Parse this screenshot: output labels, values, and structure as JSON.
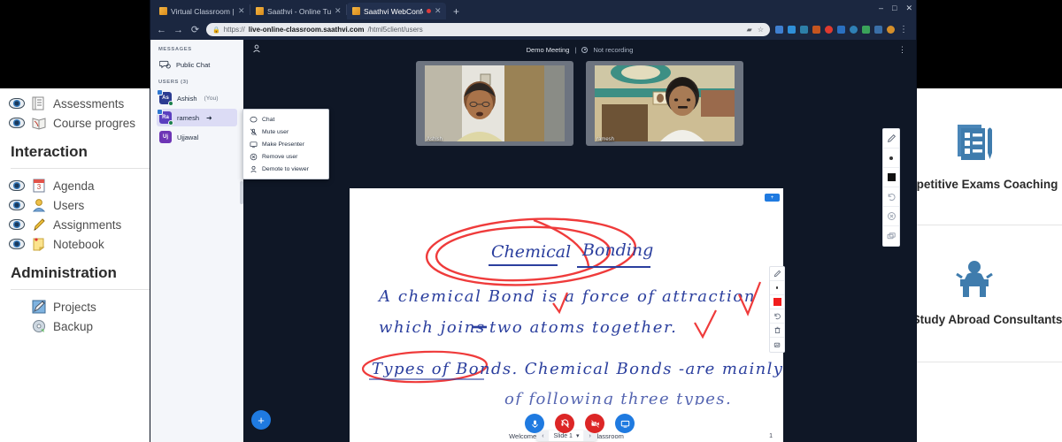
{
  "browser": {
    "tabs": [
      {
        "title": "Virtual Classroom | Live o",
        "active": false,
        "recording": false
      },
      {
        "title": "Saathvi - Online Tutor | Liv",
        "active": false,
        "recording": false
      },
      {
        "title": "Saathvi WebConferenc",
        "active": true,
        "recording": true
      }
    ],
    "new_tab_label": "+",
    "window_controls": {
      "minimize": "–",
      "maximize": "□",
      "close": "✕"
    },
    "nav": {
      "back": "←",
      "forward": "→",
      "reload": "⟳"
    },
    "omnibox": {
      "lock_icon": "lock-icon",
      "url_prefix": "https://",
      "url_domain": "live-online-classroom.saathvi.com",
      "url_path": "/html5client/users",
      "bookmark_icon": "star-icon",
      "cast_icon": "cast-icon"
    },
    "extensions": [
      "#3f7fd0",
      "#2f8fd8",
      "#2d7fa8",
      "#c4551f",
      "#e03a2f",
      "#2a6fc0",
      "#2f80b5",
      "#3aa35a",
      "#3a6fa8",
      "#d58f2a"
    ],
    "menu_icon": "kebab-menu-icon"
  },
  "meeting": {
    "title": "Demo Meeting",
    "separator": "|",
    "recording_status": "Not recording",
    "options_icon": "kebab-menu-icon",
    "user_icon": "user-list-icon"
  },
  "sidebar": {
    "messages_heading": "MESSAGES",
    "public_chat": "Public Chat",
    "users_heading": "USERS (3)",
    "users": [
      {
        "name": "Ashish",
        "suffix": "(You)",
        "initials": "As",
        "color": "#2c3c91",
        "presenter": true,
        "selected": false
      },
      {
        "name": "ramesh",
        "suffix": "",
        "initials": "Ra",
        "color": "#5b3fbf",
        "presenter": true,
        "selected": true
      },
      {
        "name": "Ujjawal",
        "suffix": "",
        "initials": "Uj",
        "color": "#6d35b5",
        "presenter": false,
        "selected": false
      }
    ]
  },
  "context_menu": {
    "items": [
      {
        "label": "Chat",
        "icon": "chat-bubble-icon"
      },
      {
        "label": "Mute user",
        "icon": "microphone-slash-icon"
      },
      {
        "label": "Make Presenter",
        "icon": "presentation-screen-icon"
      },
      {
        "label": "Remove user",
        "icon": "circle-x-icon"
      },
      {
        "label": "Demote to viewer",
        "icon": "person-icon"
      }
    ]
  },
  "videos": [
    {
      "label": "Ashish"
    },
    {
      "label": "ramesh"
    }
  ],
  "whiteboard": {
    "title_line": "Chemical Bonding",
    "body_lines": [
      "A chemical Bond is a force of attraction",
      "which joins  two atoms together.",
      "Types of Bonds. Chemical Bonds -are mainly",
      "of following three types."
    ],
    "footer_title": "Welcome To Saathvi Online Classroom",
    "page_number": "1",
    "slide_selector": {
      "prev": "‹",
      "next": "›",
      "current": "Slide 1",
      "caret": "▾"
    },
    "badge_label": "+",
    "tools": [
      {
        "icon": "pencil-tool-icon",
        "name": "pencil"
      },
      {
        "icon": "thickness-dot-icon",
        "name": "thickness"
      },
      {
        "icon": "color-swatch-icon",
        "name": "color",
        "color": "#f11c1c"
      },
      {
        "icon": "undo-icon",
        "name": "undo"
      },
      {
        "icon": "trash-icon",
        "name": "clear"
      },
      {
        "icon": "multi-user-whiteboard-icon",
        "name": "multi-user"
      }
    ],
    "outer_tools": [
      {
        "icon": "pencil-tool-icon",
        "name": "pencil"
      },
      {
        "icon": "thickness-dot-icon",
        "name": "thickness"
      },
      {
        "icon": "color-swatch-icon",
        "name": "color",
        "color": "#111111"
      },
      {
        "icon": "undo-icon",
        "name": "undo"
      },
      {
        "icon": "circle-x-icon",
        "name": "clear-all"
      },
      {
        "icon": "multi-user-whiteboard-icon",
        "name": "multi-user"
      }
    ]
  },
  "actionbar": {
    "add_label": "+",
    "buttons": [
      {
        "name": "microphone-button",
        "icon": "microphone-icon",
        "state": "blue"
      },
      {
        "name": "leave-audio-button",
        "icon": "headset-slash-icon",
        "state": "red"
      },
      {
        "name": "camera-button",
        "icon": "camera-slash-icon",
        "state": "red"
      },
      {
        "name": "share-screen-button",
        "icon": "screen-share-icon",
        "state": "blue"
      }
    ]
  },
  "lms_left": {
    "top_items": [
      {
        "label": "Assessments",
        "icon": "assessments-icon"
      },
      {
        "label": "Course progres",
        "icon": "course-progress-icon"
      }
    ],
    "sections": [
      {
        "heading": "Interaction",
        "items": [
          {
            "label": "Agenda",
            "icon": "agenda-icon"
          },
          {
            "label": "Users",
            "icon": "users-icon"
          },
          {
            "label": "Assignments",
            "icon": "assignments-icon"
          },
          {
            "label": "Notebook",
            "icon": "notebook-icon"
          }
        ]
      },
      {
        "heading": "Administration",
        "items": [
          {
            "label": "Projects",
            "icon": "projects-icon"
          },
          {
            "label": "Backup",
            "icon": "backup-icon"
          }
        ]
      }
    ]
  },
  "lms_right": {
    "cards": [
      {
        "label": "Competitive Exams Coaching",
        "icon": "exam-paper-pencil-icon"
      },
      {
        "label": "Study Abroad Consultants",
        "icon": "lecture-desk-icon"
      }
    ]
  },
  "colors": {
    "accent_blue": "#1f7ae0",
    "danger_red": "#dc2626",
    "marker_red": "#ef3b3b",
    "ink_blue": "#2b3f9e",
    "app_dark": "#0f1726",
    "chrome_dark": "#1b2740"
  }
}
